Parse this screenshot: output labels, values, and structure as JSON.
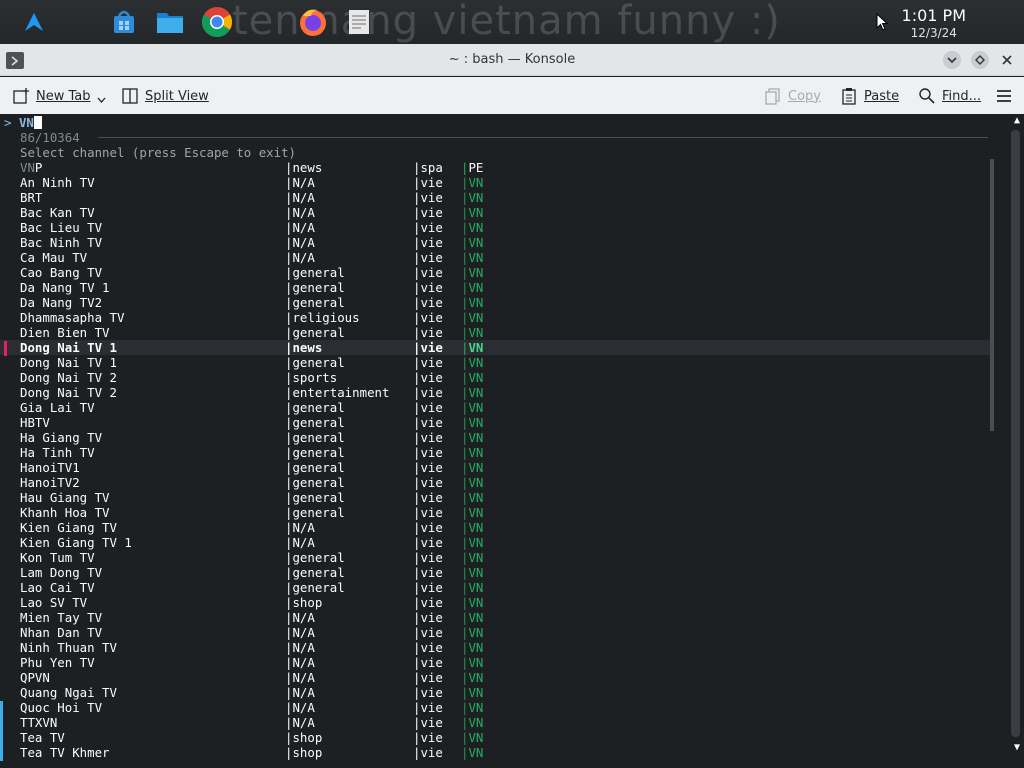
{
  "taskbar": {
    "wallpaper_text": "ten nang vietnam funny :)",
    "clock_time": "1:01 PM",
    "clock_date": "12/3/24",
    "icons": [
      "launcher-icon",
      "store-icon",
      "file-manager-icon",
      "chrome-icon",
      "firefox-icon",
      "text-editor-icon"
    ]
  },
  "window": {
    "title": "~ : bash — Konsole"
  },
  "toolbar": {
    "new_tab": "New Tab",
    "split_view": "Split View",
    "copy": "Copy",
    "paste": "Paste",
    "find": "Find..."
  },
  "terminal": {
    "prompt_arrow": ">",
    "query": "VN",
    "count": "86/10364",
    "help": "Select channel (press Escape to exit)",
    "header": {
      "name": "VNP",
      "category": "news",
      "language": "spa",
      "country": "PE"
    },
    "selected_index": 11,
    "rows": [
      {
        "name": "An Ninh TV",
        "category": "N/A",
        "language": "vie",
        "country": "VN"
      },
      {
        "name": "BRT",
        "category": "N/A",
        "language": "vie",
        "country": "VN"
      },
      {
        "name": "Bac Kan TV",
        "category": "N/A",
        "language": "vie",
        "country": "VN"
      },
      {
        "name": "Bac Lieu TV",
        "category": "N/A",
        "language": "vie",
        "country": "VN"
      },
      {
        "name": "Bac Ninh TV",
        "category": "N/A",
        "language": "vie",
        "country": "VN"
      },
      {
        "name": "Ca Mau TV",
        "category": "N/A",
        "language": "vie",
        "country": "VN"
      },
      {
        "name": "Cao Bang TV",
        "category": "general",
        "language": "vie",
        "country": "VN"
      },
      {
        "name": "Da Nang TV 1",
        "category": "general",
        "language": "vie",
        "country": "VN"
      },
      {
        "name": "Da Nang TV2",
        "category": "general",
        "language": "vie",
        "country": "VN"
      },
      {
        "name": "Dhammasapha TV",
        "category": "religious",
        "language": "vie",
        "country": "VN"
      },
      {
        "name": "Dien Bien TV",
        "category": "general",
        "language": "vie",
        "country": "VN"
      },
      {
        "name": "Dong Nai TV 1",
        "category": "news",
        "language": "vie",
        "country": "VN"
      },
      {
        "name": "Dong Nai TV 1",
        "category": "general",
        "language": "vie",
        "country": "VN"
      },
      {
        "name": "Dong Nai TV 2",
        "category": "sports",
        "language": "vie",
        "country": "VN"
      },
      {
        "name": "Dong Nai TV 2",
        "category": "entertainment",
        "language": "vie",
        "country": "VN"
      },
      {
        "name": "Gia Lai TV",
        "category": "general",
        "language": "vie",
        "country": "VN"
      },
      {
        "name": "HBTV",
        "category": "general",
        "language": "vie",
        "country": "VN"
      },
      {
        "name": "Ha Giang TV",
        "category": "general",
        "language": "vie",
        "country": "VN"
      },
      {
        "name": "Ha Tinh TV",
        "category": "general",
        "language": "vie",
        "country": "VN"
      },
      {
        "name": "HanoiTV1",
        "category": "general",
        "language": "vie",
        "country": "VN"
      },
      {
        "name": "HanoiTV2",
        "category": "general",
        "language": "vie",
        "country": "VN"
      },
      {
        "name": "Hau Giang TV",
        "category": "general",
        "language": "vie",
        "country": "VN"
      },
      {
        "name": "Khanh Hoa TV",
        "category": "general",
        "language": "vie",
        "country": "VN"
      },
      {
        "name": "Kien Giang TV",
        "category": "N/A",
        "language": "vie",
        "country": "VN"
      },
      {
        "name": "Kien Giang TV 1",
        "category": "N/A",
        "language": "vie",
        "country": "VN"
      },
      {
        "name": "Kon Tum TV",
        "category": "general",
        "language": "vie",
        "country": "VN"
      },
      {
        "name": "Lam Dong TV",
        "category": "general",
        "language": "vie",
        "country": "VN"
      },
      {
        "name": "Lao Cai TV",
        "category": "general",
        "language": "vie",
        "country": "VN"
      },
      {
        "name": "Lao SV TV",
        "category": "shop",
        "language": "vie",
        "country": "VN"
      },
      {
        "name": "Mien Tay TV",
        "category": "N/A",
        "language": "vie",
        "country": "VN"
      },
      {
        "name": "Nhan Dan TV",
        "category": "N/A",
        "language": "vie",
        "country": "VN"
      },
      {
        "name": "Ninh Thuan TV",
        "category": "N/A",
        "language": "vie",
        "country": "VN"
      },
      {
        "name": "Phu Yen TV",
        "category": "N/A",
        "language": "vie",
        "country": "VN"
      },
      {
        "name": "QPVN",
        "category": "N/A",
        "language": "vie",
        "country": "VN"
      },
      {
        "name": "Quang Ngai TV",
        "category": "N/A",
        "language": "vie",
        "country": "VN"
      },
      {
        "name": "Quoc Hoi TV",
        "category": "N/A",
        "language": "vie",
        "country": "VN"
      },
      {
        "name": "TTXVN",
        "category": "N/A",
        "language": "vie",
        "country": "VN"
      },
      {
        "name": "Tea TV",
        "category": "shop",
        "language": "vie",
        "country": "VN"
      },
      {
        "name": "Tea TV Khmer",
        "category": "shop",
        "language": "vie",
        "country": "VN"
      }
    ]
  }
}
